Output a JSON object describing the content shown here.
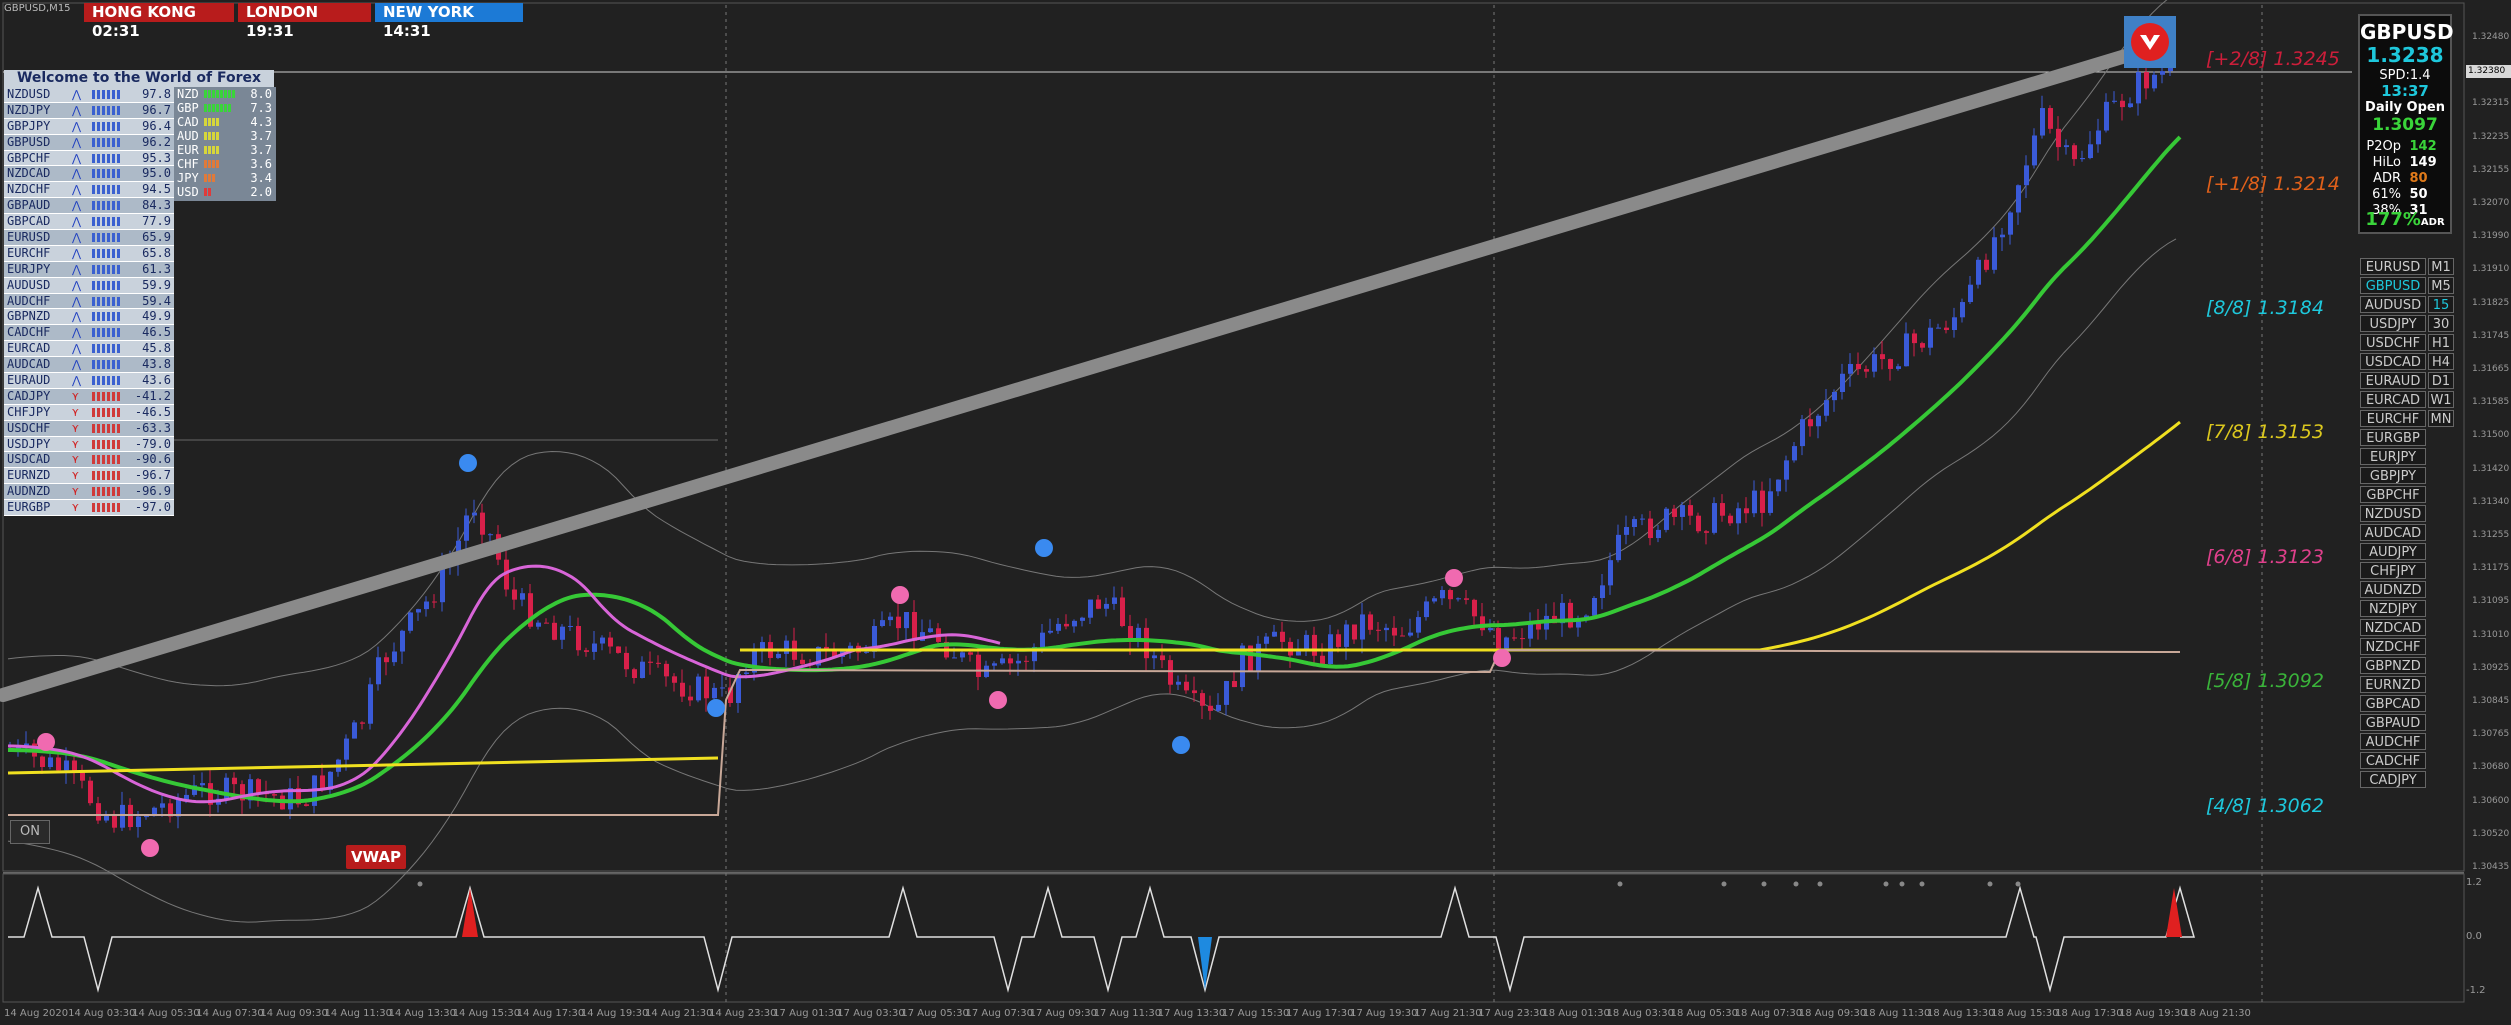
{
  "chart": {
    "symbol_label": "GBPUSD,M15",
    "on_button": "ON",
    "vwap_label": "VWAP"
  },
  "sessions": [
    {
      "label": "HONG KONG 02:31",
      "color": "#b81c1c"
    },
    {
      "label": "LONDON  19:31",
      "color": "#b81c1c"
    },
    {
      "label": "NEW YORK 14:31",
      "color": "#1c7ad6"
    }
  ],
  "strength_panel": {
    "title": "Welcome to the World of Forex",
    "pairs": [
      {
        "name": "NZDUSD",
        "value": "97.8",
        "dir": "up"
      },
      {
        "name": "NZDJPY",
        "value": "96.7",
        "dir": "up"
      },
      {
        "name": "GBPJPY",
        "value": "96.4",
        "dir": "up"
      },
      {
        "name": "GBPUSD",
        "value": "96.2",
        "dir": "up"
      },
      {
        "name": "GBPCHF",
        "value": "95.3",
        "dir": "up"
      },
      {
        "name": "NZDCAD",
        "value": "95.0",
        "dir": "up"
      },
      {
        "name": "NZDCHF",
        "value": "94.5",
        "dir": "up"
      },
      {
        "name": "GBPAUD",
        "value": "84.3",
        "dir": "up"
      },
      {
        "name": "GBPCAD",
        "value": "77.9",
        "dir": "up"
      },
      {
        "name": "EURUSD",
        "value": "65.9",
        "dir": "up"
      },
      {
        "name": "EURCHF",
        "value": "65.8",
        "dir": "up"
      },
      {
        "name": "EURJPY",
        "value": "61.3",
        "dir": "up"
      },
      {
        "name": "AUDUSD",
        "value": "59.9",
        "dir": "up"
      },
      {
        "name": "AUDCHF",
        "value": "59.4",
        "dir": "up"
      },
      {
        "name": "GBPNZD",
        "value": "49.9",
        "dir": "up"
      },
      {
        "name": "CADCHF",
        "value": "46.5",
        "dir": "up"
      },
      {
        "name": "EURCAD",
        "value": "45.8",
        "dir": "up"
      },
      {
        "name": "AUDCAD",
        "value": "43.8",
        "dir": "up"
      },
      {
        "name": "EURAUD",
        "value": "43.6",
        "dir": "up"
      },
      {
        "name": "CADJPY",
        "value": "-41.2",
        "dir": "down"
      },
      {
        "name": "CHFJPY",
        "value": "-46.5",
        "dir": "down"
      },
      {
        "name": "USDCHF",
        "value": "-63.3",
        "dir": "down"
      },
      {
        "name": "USDJPY",
        "value": "-79.0",
        "dir": "down"
      },
      {
        "name": "USDCAD",
        "value": "-90.6",
        "dir": "down"
      },
      {
        "name": "EURNZD",
        "value": "-96.7",
        "dir": "down"
      },
      {
        "name": "AUDNZD",
        "value": "-96.9",
        "dir": "down"
      },
      {
        "name": "EURGBP",
        "value": "-97.0",
        "dir": "down"
      }
    ],
    "currencies": [
      {
        "name": "NZD",
        "value": "8.0",
        "color": "#3ad43a"
      },
      {
        "name": "GBP",
        "value": "7.3",
        "color": "#3ad43a"
      },
      {
        "name": "CAD",
        "value": "4.3",
        "color": "#d6d63a"
      },
      {
        "name": "AUD",
        "value": "3.7",
        "color": "#d6d63a"
      },
      {
        "name": "EUR",
        "value": "3.7",
        "color": "#d6d63a"
      },
      {
        "name": "CHF",
        "value": "3.6",
        "color": "#e07a3a"
      },
      {
        "name": "JPY",
        "value": "3.4",
        "color": "#e07a3a"
      },
      {
        "name": "USD",
        "value": "2.0",
        "color": "#e03a3a"
      }
    ]
  },
  "info_panel": {
    "symbol": "GBPUSD",
    "price": "1.3238",
    "spread": "SPD:1.4",
    "time": "13:37",
    "daily_open_label": "Daily Open",
    "daily_open": "1.3097",
    "stats": [
      {
        "label": "P2Op",
        "value": "142",
        "color": "#3ad43a"
      },
      {
        "label": "HiLo",
        "value": "149",
        "color": "#ffffff"
      },
      {
        "label": "ADR",
        "value": "80",
        "color": "#e07a1a"
      },
      {
        "label": "61%",
        "value": "50",
        "color": "#ffffff"
      },
      {
        "label": "38%",
        "value": "31",
        "color": "#ffffff"
      }
    ],
    "adr_pct": "177%",
    "adr_suffix": "ADR"
  },
  "symbol_buttons": [
    "EURUSD",
    "GBPUSD",
    "AUDUSD",
    "USDJPY",
    "USDCHF",
    "USDCAD",
    "EURAUD",
    "EURCAD",
    "EURCHF",
    "EURGBP",
    "EURJPY",
    "GBPJPY",
    "GBPCHF",
    "NZDUSD",
    "AUDCAD",
    "AUDJPY",
    "CHFJPY",
    "AUDNZD",
    "NZDJPY",
    "NZDCAD",
    "NZDCHF",
    "GBPNZD",
    "EURNZD",
    "GBPCAD",
    "GBPAUD",
    "AUDCHF",
    "CADCHF",
    "CADJPY"
  ],
  "active_symbol": "GBPUSD",
  "timeframe_buttons": [
    "M1",
    "M5",
    "15",
    "30",
    "H1",
    "H4",
    "D1",
    "W1",
    "MN"
  ],
  "active_timeframe": "15",
  "murrey_levels": [
    {
      "label": "[+2/8]  1.3245",
      "color": "#cc1e3a"
    },
    {
      "label": "[+1/8]  1.3214",
      "color": "#e0601a"
    },
    {
      "label": "[8/8]  1.3184",
      "color": "#1ec8dc"
    },
    {
      "label": "[7/8]  1.3153",
      "color": "#dcc81e"
    },
    {
      "label": "[6/8]  1.3123",
      "color": "#e0408c"
    },
    {
      "label": "[5/8]  1.3092",
      "color": "#3ab43a"
    },
    {
      "label": "[4/8]  1.3062",
      "color": "#1ec8dc"
    }
  ],
  "price_axis": [
    "1.32480",
    "1.32400",
    "1.32315",
    "1.32235",
    "1.32155",
    "1.32070",
    "1.31990",
    "1.31910",
    "1.31825",
    "1.31745",
    "1.31665",
    "1.31585",
    "1.31500",
    "1.31420",
    "1.31340",
    "1.31255",
    "1.31175",
    "1.31095",
    "1.31010",
    "1.30925",
    "1.30845",
    "1.30765",
    "1.30680",
    "1.30600",
    "1.30520",
    "1.30435"
  ],
  "current_price_tag": "1.32380",
  "osc_axis": [
    "1.2",
    "0.0",
    "-1.2"
  ],
  "time_axis": [
    "14 Aug 2020",
    "14 Aug 03:30",
    "14 Aug 05:30",
    "14 Aug 07:30",
    "14 Aug 09:30",
    "14 Aug 11:30",
    "14 Aug 13:30",
    "14 Aug 15:30",
    "14 Aug 17:30",
    "14 Aug 19:30",
    "14 Aug 21:30",
    "14 Aug 23:30",
    "17 Aug 01:30",
    "17 Aug 03:30",
    "17 Aug 05:30",
    "17 Aug 07:30",
    "17 Aug 09:30",
    "17 Aug 11:30",
    "17 Aug 13:30",
    "17 Aug 15:30",
    "17 Aug 17:30",
    "17 Aug 19:30",
    "17 Aug 21:30",
    "17 Aug 23:30",
    "18 Aug 01:30",
    "18 Aug 03:30",
    "18 Aug 05:30",
    "18 Aug 07:30",
    "18 Aug 09:30",
    "18 Aug 11:30",
    "18 Aug 13:30",
    "18 Aug 15:30",
    "18 Aug 17:30",
    "18 Aug 19:30",
    "18 Aug 21:30"
  ]
}
